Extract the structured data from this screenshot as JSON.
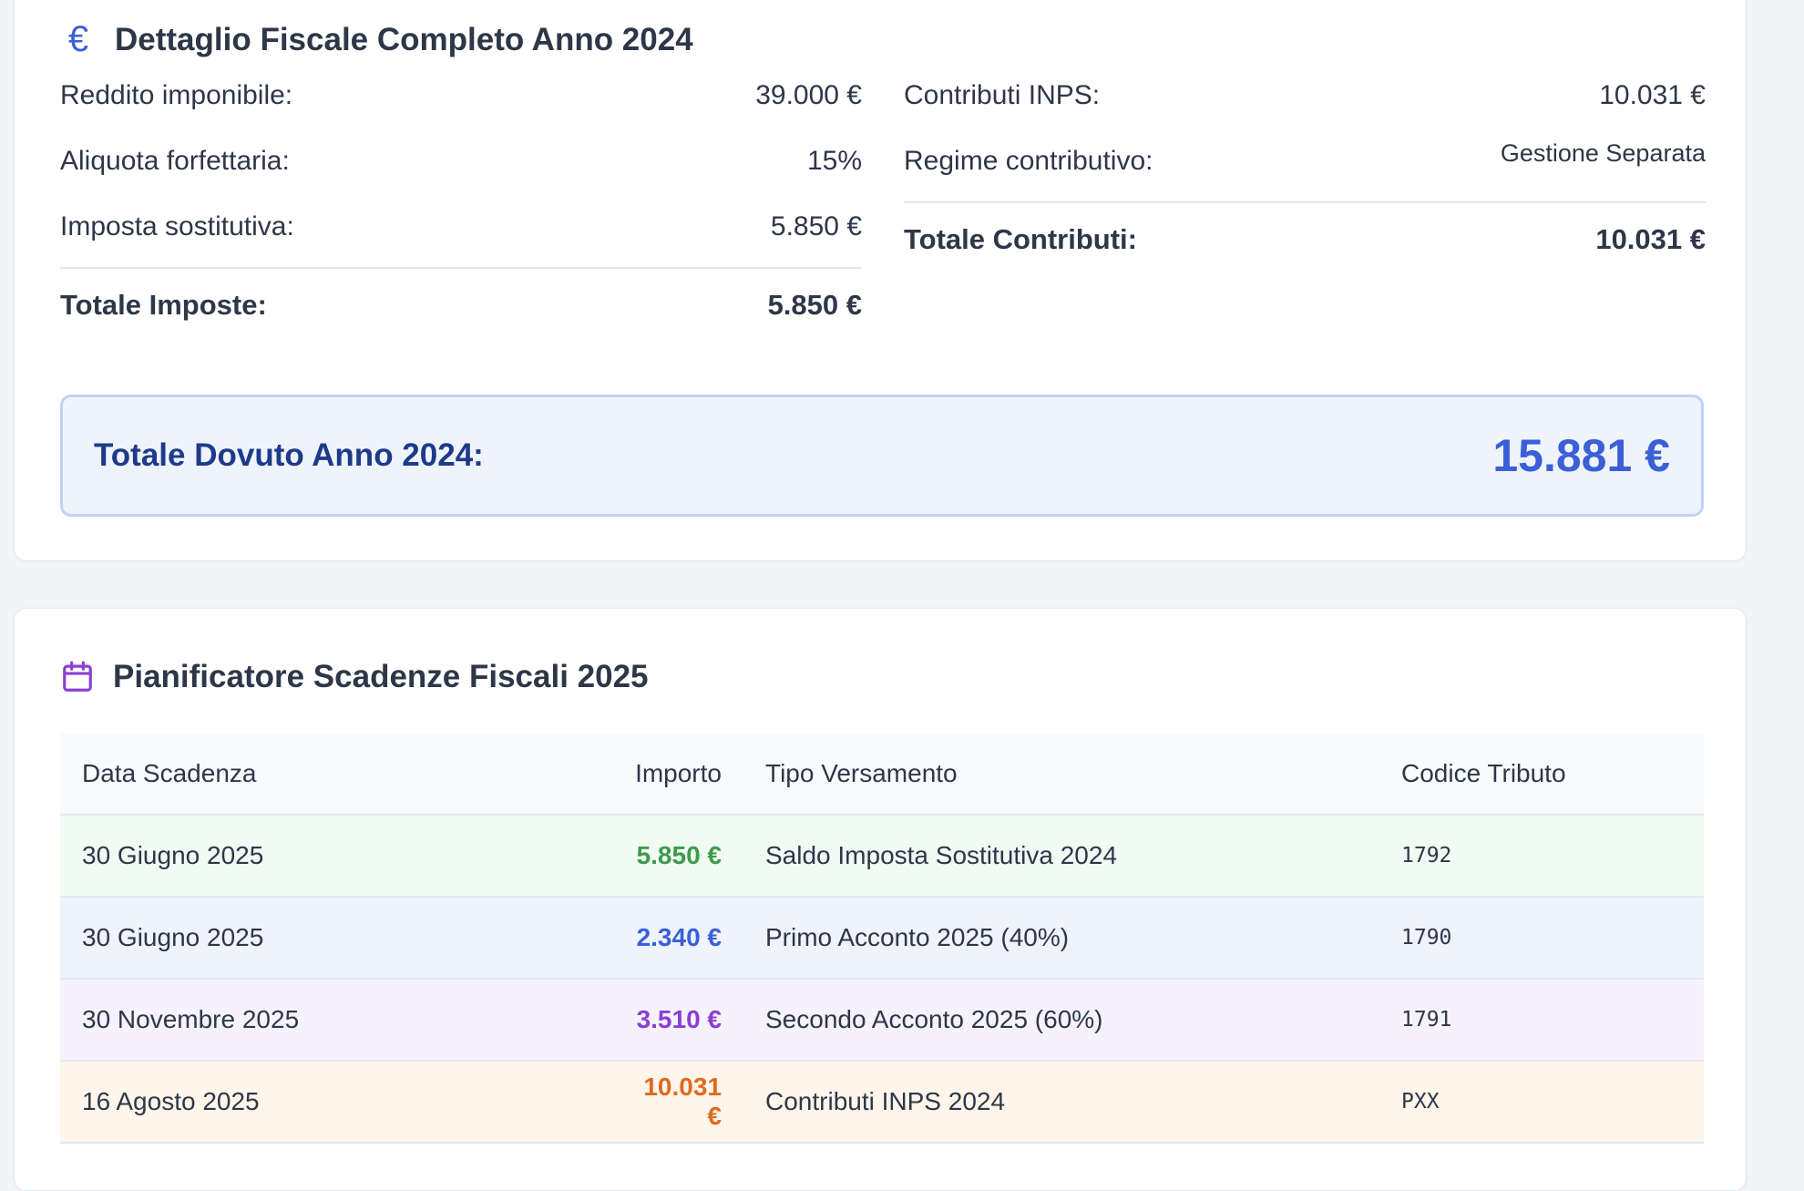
{
  "fiscal_detail": {
    "title": "Dettaglio Fiscale Completo Anno 2024",
    "left": {
      "rows": [
        {
          "label": "Reddito imponibile:",
          "value": "39.000 €"
        },
        {
          "label": "Aliquota forfettaria:",
          "value": "15%"
        },
        {
          "label": "Imposta sostitutiva:",
          "value": "5.850 €"
        }
      ],
      "total_label": "Totale Imposte:",
      "total_value": "5.850 €"
    },
    "right": {
      "rows": [
        {
          "label": "Contributi INPS:",
          "value": "10.031 €"
        },
        {
          "label": "Regime contributivo:",
          "value": "Gestione Separata"
        }
      ],
      "total_label": "Totale Contributi:",
      "total_value": "10.031 €"
    },
    "grand_total_label": "Totale Dovuto Anno 2024:",
    "grand_total_value": "15.881 €"
  },
  "planner": {
    "title": "Pianificatore Scadenze Fiscali 2025",
    "columns": [
      "Data Scadenza",
      "Importo",
      "Tipo Versamento",
      "Codice Tributo"
    ],
    "rows": [
      {
        "date": "30 Giugno 2025",
        "amount": "5.850 €",
        "type": "Saldo Imposta Sostitutiva 2024",
        "code": "1792",
        "accent": "#3d9b4a"
      },
      {
        "date": "30 Giugno 2025",
        "amount": "2.340 €",
        "type": "Primo Acconto 2025 (40%)",
        "code": "1790",
        "accent": "#3b5fd6"
      },
      {
        "date": "30 Novembre 2025",
        "amount": "3.510 €",
        "type": "Secondo Acconto 2025 (60%)",
        "code": "1791",
        "accent": "#8b3fd4"
      },
      {
        "date": "16 Agosto 2025",
        "amount": "10.031 €",
        "type": "Contributi INPS 2024",
        "code": "PXX",
        "accent": "#dd6b20"
      }
    ]
  },
  "icons": {
    "fiscal": "euro-icon",
    "planner": "calendar-icon"
  }
}
